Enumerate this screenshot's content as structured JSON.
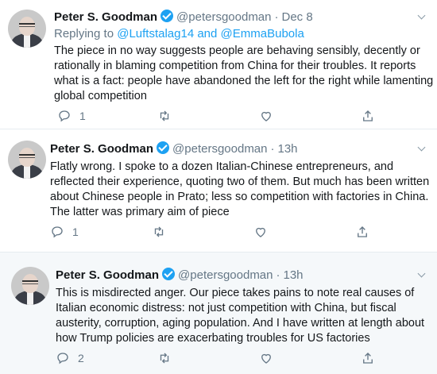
{
  "tweets": [
    {
      "author": "Peter S. Goodman",
      "handle": "@petersgoodman",
      "separator": "·",
      "time": "Dec 8",
      "replying_label": "Replying to",
      "replying_users": "@Luftstalag14 and @EmmaBubola",
      "body": "The piece in no way suggests people are behaving sensibly, decently or rationally in blaming competition from China for their troubles. It reports what is a fact: people have abandoned the left for the right while lamenting global competition",
      "reply_count": "1"
    },
    {
      "author": "Peter S. Goodman",
      "handle": "@petersgoodman",
      "separator": "·",
      "time": "13h",
      "body": "Flatly wrong. I spoke to a dozen Italian-Chinese entrepreneurs, and reflected their experience, quoting two of them. But much has been written about Chinese people in Prato; less so competition with factories in China. The latter was primary aim of piece",
      "reply_count": "1"
    },
    {
      "author": "Peter S. Goodman",
      "handle": "@petersgoodman",
      "separator": "·",
      "time": "13h",
      "body": "This is misdirected anger. Our piece takes pains to note real causes of Italian economic distress: not just competition with China, but fiscal austerity, corruption, aging population. And I have written at length about how Trump policies are exacerbating troubles for US factories",
      "reply_count": "2"
    }
  ],
  "colors": {
    "accent": "#1da1f2",
    "muted": "#657786",
    "highlight_bg": "#f5f8fa"
  },
  "icons": {
    "reply": "comment-icon",
    "retweet": "retweet-icon",
    "like": "heart-icon",
    "share": "share-icon",
    "verified": "verified-badge-icon",
    "menu": "chevron-down-icon"
  }
}
